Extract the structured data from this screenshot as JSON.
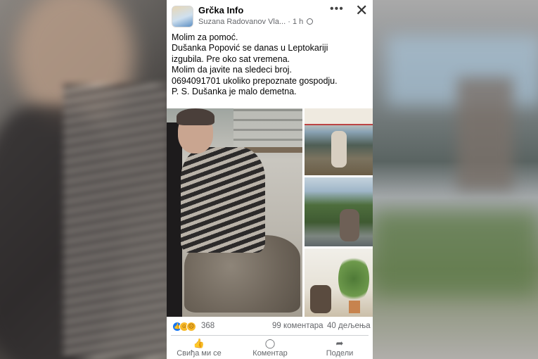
{
  "post": {
    "page_name": "Grčka Info",
    "author": "Suzana Radovanov Vla...",
    "time": "1 h",
    "text_lines": [
      "Molim za pomoć.",
      "Dušanka Popović se danas u Leptokariji",
      "izgubila. Pre oko sat vremena.",
      "Molim da javite na sledeci broj.",
      "0694091701 ukoliko prepoznate gospodju.",
      "P. S. Dušanka je malo demetna."
    ]
  },
  "stats": {
    "reactions_count": "368",
    "comments": "99 коментара",
    "shares": "40 дељења"
  },
  "actions": {
    "like": "Свиђа ми се",
    "comment": "Коментар",
    "share": "Подели"
  },
  "icons": {
    "more": "more-icon",
    "close": "close-icon",
    "like": "thumb-up-icon",
    "comment": "speech-bubble-icon",
    "share": "share-arrow-icon"
  },
  "colors": {
    "like_blue": "#1877f2",
    "reaction_yellow": "#f7b928",
    "secondary_text": "#65676b"
  }
}
